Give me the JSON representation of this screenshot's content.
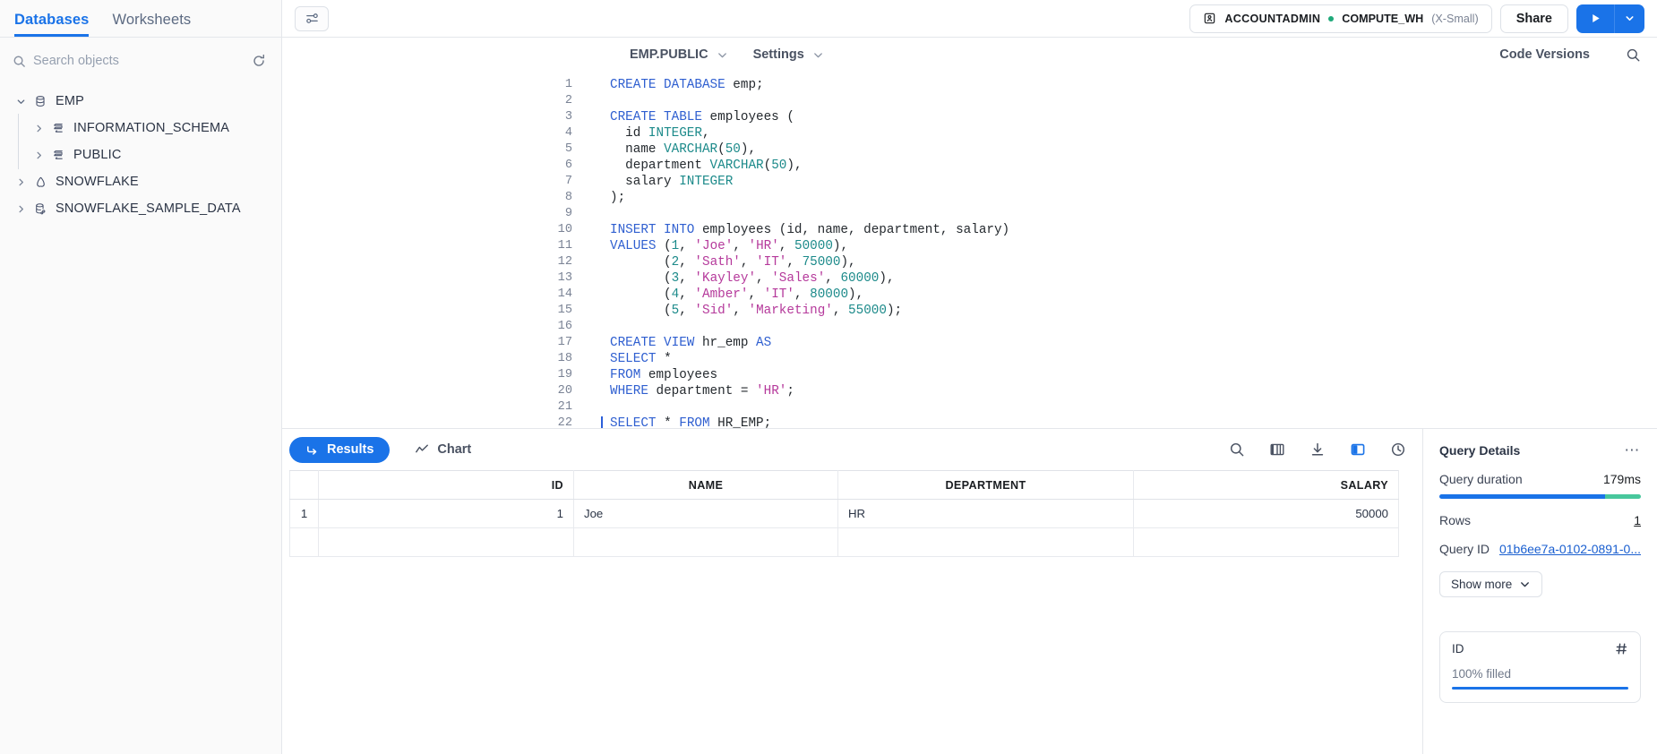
{
  "sidebar": {
    "tabs": [
      {
        "label": "Databases",
        "active": true
      },
      {
        "label": "Worksheets",
        "active": false
      }
    ],
    "search": {
      "placeholder": "Search objects",
      "value": ""
    },
    "refresh_icon": "refresh-icon",
    "tree": [
      {
        "label": "EMP",
        "level": 0,
        "icon": "database-icon",
        "expanded": true
      },
      {
        "label": "INFORMATION_SCHEMA",
        "level": 1,
        "icon": "schema-icon",
        "expanded": false
      },
      {
        "label": "PUBLIC",
        "level": 1,
        "icon": "schema-icon",
        "expanded": false
      },
      {
        "label": "SNOWFLAKE",
        "level": 0,
        "icon": "snowflake-db-icon",
        "expanded": false
      },
      {
        "label": "SNOWFLAKE_SAMPLE_DATA",
        "level": 0,
        "icon": "shared-database-icon",
        "expanded": false
      }
    ]
  },
  "topbar": {
    "filter_icon": "sliders-icon",
    "role": "ACCOUNTADMIN",
    "role_icon": "badge-icon",
    "status_dot_color": "#1fa97a",
    "warehouse": "COMPUTE_WH",
    "warehouse_size": "(X-Small)",
    "share_label": "Share",
    "run_icon": "play-icon",
    "run_caret_icon": "chevron-down-icon",
    "accent": "#1a73e8"
  },
  "editor_header": {
    "context_label": "EMP.PUBLIC",
    "settings_label": "Settings",
    "code_versions_label": "Code Versions",
    "search_icon": "search-icon"
  },
  "editor": {
    "cursor_line": 22,
    "lines": [
      {
        "n": 1,
        "tokens": [
          {
            "t": "k",
            "v": "CREATE DATABASE"
          },
          {
            "t": "id",
            "v": " emp"
          },
          {
            "t": "p",
            "v": ";"
          }
        ]
      },
      {
        "n": 2,
        "tokens": []
      },
      {
        "n": 3,
        "tokens": [
          {
            "t": "k",
            "v": "CREATE TABLE"
          },
          {
            "t": "id",
            "v": " employees ("
          }
        ]
      },
      {
        "n": 4,
        "tokens": [
          {
            "t": "id",
            "v": "  id "
          },
          {
            "t": "t",
            "v": "INTEGER"
          },
          {
            "t": "p",
            "v": ","
          }
        ]
      },
      {
        "n": 5,
        "tokens": [
          {
            "t": "id",
            "v": "  name "
          },
          {
            "t": "t",
            "v": "VARCHAR"
          },
          {
            "t": "p",
            "v": "("
          },
          {
            "t": "t",
            "v": "50"
          },
          {
            "t": "p",
            "v": "),"
          }
        ]
      },
      {
        "n": 6,
        "tokens": [
          {
            "t": "id",
            "v": "  department "
          },
          {
            "t": "t",
            "v": "VARCHAR"
          },
          {
            "t": "p",
            "v": "("
          },
          {
            "t": "t",
            "v": "50"
          },
          {
            "t": "p",
            "v": "),"
          }
        ]
      },
      {
        "n": 7,
        "tokens": [
          {
            "t": "id",
            "v": "  salary "
          },
          {
            "t": "t",
            "v": "INTEGER"
          }
        ]
      },
      {
        "n": 8,
        "tokens": [
          {
            "t": "p",
            "v": ");"
          }
        ]
      },
      {
        "n": 9,
        "tokens": []
      },
      {
        "n": 10,
        "tokens": [
          {
            "t": "k",
            "v": "INSERT INTO"
          },
          {
            "t": "id",
            "v": " employees (id, name, department, salary)"
          }
        ]
      },
      {
        "n": 11,
        "tokens": [
          {
            "t": "k",
            "v": "VALUES"
          },
          {
            "t": "p",
            "v": " ("
          },
          {
            "t": "t",
            "v": "1"
          },
          {
            "t": "p",
            "v": ", "
          },
          {
            "t": "s",
            "v": "'Joe'"
          },
          {
            "t": "p",
            "v": ", "
          },
          {
            "t": "s",
            "v": "'HR'"
          },
          {
            "t": "p",
            "v": ", "
          },
          {
            "t": "t",
            "v": "50000"
          },
          {
            "t": "p",
            "v": "),"
          }
        ]
      },
      {
        "n": 12,
        "tokens": [
          {
            "t": "p",
            "v": "       ("
          },
          {
            "t": "t",
            "v": "2"
          },
          {
            "t": "p",
            "v": ", "
          },
          {
            "t": "s",
            "v": "'Sath'"
          },
          {
            "t": "p",
            "v": ", "
          },
          {
            "t": "s",
            "v": "'IT'"
          },
          {
            "t": "p",
            "v": ", "
          },
          {
            "t": "t",
            "v": "75000"
          },
          {
            "t": "p",
            "v": "),"
          }
        ]
      },
      {
        "n": 13,
        "tokens": [
          {
            "t": "p",
            "v": "       ("
          },
          {
            "t": "t",
            "v": "3"
          },
          {
            "t": "p",
            "v": ", "
          },
          {
            "t": "s",
            "v": "'Kayley'"
          },
          {
            "t": "p",
            "v": ", "
          },
          {
            "t": "s",
            "v": "'Sales'"
          },
          {
            "t": "p",
            "v": ", "
          },
          {
            "t": "t",
            "v": "60000"
          },
          {
            "t": "p",
            "v": "),"
          }
        ]
      },
      {
        "n": 14,
        "tokens": [
          {
            "t": "p",
            "v": "       ("
          },
          {
            "t": "t",
            "v": "4"
          },
          {
            "t": "p",
            "v": ", "
          },
          {
            "t": "s",
            "v": "'Amber'"
          },
          {
            "t": "p",
            "v": ", "
          },
          {
            "t": "s",
            "v": "'IT'"
          },
          {
            "t": "p",
            "v": ", "
          },
          {
            "t": "t",
            "v": "80000"
          },
          {
            "t": "p",
            "v": "),"
          }
        ]
      },
      {
        "n": 15,
        "tokens": [
          {
            "t": "p",
            "v": "       ("
          },
          {
            "t": "t",
            "v": "5"
          },
          {
            "t": "p",
            "v": ", "
          },
          {
            "t": "s",
            "v": "'Sid'"
          },
          {
            "t": "p",
            "v": ", "
          },
          {
            "t": "s",
            "v": "'Marketing'"
          },
          {
            "t": "p",
            "v": ", "
          },
          {
            "t": "t",
            "v": "55000"
          },
          {
            "t": "p",
            "v": ");"
          }
        ]
      },
      {
        "n": 16,
        "tokens": []
      },
      {
        "n": 17,
        "tokens": [
          {
            "t": "k",
            "v": "CREATE VIEW"
          },
          {
            "t": "id",
            "v": " hr_emp "
          },
          {
            "t": "k",
            "v": "AS"
          }
        ]
      },
      {
        "n": 18,
        "tokens": [
          {
            "t": "k",
            "v": "SELECT"
          },
          {
            "t": "p",
            "v": " *"
          }
        ]
      },
      {
        "n": 19,
        "tokens": [
          {
            "t": "k",
            "v": "FROM"
          },
          {
            "t": "id",
            "v": " employees"
          }
        ]
      },
      {
        "n": 20,
        "tokens": [
          {
            "t": "k",
            "v": "WHERE"
          },
          {
            "t": "id",
            "v": " department "
          },
          {
            "t": "p",
            "v": "= "
          },
          {
            "t": "s",
            "v": "'HR'"
          },
          {
            "t": "p",
            "v": ";"
          }
        ]
      },
      {
        "n": 21,
        "tokens": []
      },
      {
        "n": 22,
        "tokens": [
          {
            "t": "k",
            "v": "SELECT"
          },
          {
            "t": "p",
            "v": " * "
          },
          {
            "t": "k",
            "v": "FROM"
          },
          {
            "t": "id",
            "v": " HR_EMP"
          },
          {
            "t": "p",
            "v": ";"
          }
        ]
      }
    ]
  },
  "results": {
    "tabs": [
      {
        "label": "Results",
        "icon": "return-arrow-icon",
        "active": true
      },
      {
        "label": "Chart",
        "icon": "line-chart-icon",
        "active": false
      }
    ],
    "toolbar_icons": [
      {
        "name": "search-icon",
        "active": false
      },
      {
        "name": "columns-icon",
        "active": false
      },
      {
        "name": "download-icon",
        "active": false
      },
      {
        "name": "split-pane-icon",
        "active": true
      },
      {
        "name": "history-icon",
        "active": false
      }
    ],
    "columns": [
      "",
      "ID",
      "NAME",
      "DEPARTMENT",
      "SALARY"
    ],
    "rows": [
      {
        "index": "1",
        "ID": "1",
        "NAME": "Joe",
        "DEPARTMENT": "HR",
        "SALARY": "50000"
      }
    ]
  },
  "query_details": {
    "title": "Query Details",
    "more_icon": "ellipsis-icon",
    "duration_label": "Query duration",
    "duration_value": "179ms",
    "duration_bar": {
      "blue_pct": 82,
      "green_pct": 18,
      "blue": "#1a73e8",
      "green": "#48c79c"
    },
    "rows_label": "Rows",
    "rows_value": "1",
    "query_id_label": "Query ID",
    "query_id_value": "01b6ee7a-0102-0891-0...",
    "show_more_label": "Show more",
    "column_card": {
      "name": "ID",
      "type_icon": "hash-icon",
      "fill_text": "100% filled",
      "fill_pct": 100
    }
  }
}
